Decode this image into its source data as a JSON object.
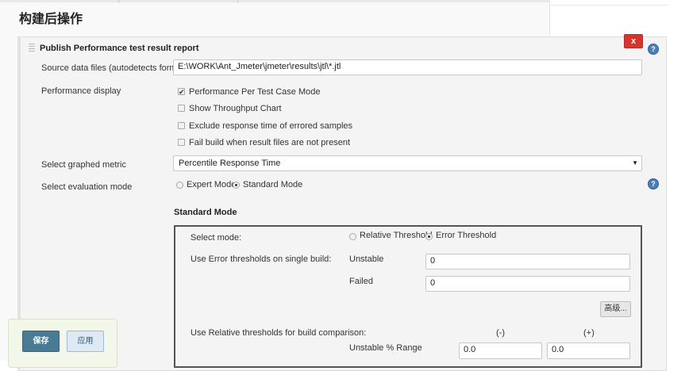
{
  "section": {
    "heading": "构建后操作"
  },
  "panel": {
    "title": "Publish Performance test result report",
    "delete_label": "x",
    "help_symbol": "?"
  },
  "form": {
    "source_label": "Source data files (autodetects format):",
    "source_value": "E:\\WORK\\Ant_Jmeter\\jmeter\\results\\jtl\\*.jtl",
    "display_label": "Performance display",
    "display_options": [
      {
        "label": "Performance Per Test Case Mode",
        "checked": true
      },
      {
        "label": "Show Throughput Chart",
        "checked": false
      },
      {
        "label": "Exclude response time of errored samples",
        "checked": false
      },
      {
        "label": "Fail build when result files are not present",
        "checked": false
      }
    ],
    "metric_label": "Select graphed metric",
    "metric_value": "Percentile Response Time",
    "eval_label": "Select evaluation mode",
    "eval_options": [
      {
        "label": "Expert Mode",
        "checked": false
      },
      {
        "label": "Standard Mode",
        "checked": true
      }
    ]
  },
  "standard_mode": {
    "heading": "Standard Mode",
    "select_mode_label": "Select mode:",
    "mode_options": [
      {
        "label": "Relative Threshold",
        "checked": false
      },
      {
        "label": "Error Threshold",
        "checked": true
      }
    ],
    "error_thresholds_label": "Use Error thresholds on single build:",
    "unstable_label": "Unstable",
    "unstable_value": "0",
    "failed_label": "Failed",
    "failed_value": "0",
    "advanced_label": "高级...",
    "relative_label": "Use Relative thresholds for build comparison:",
    "minus_header": "(-)",
    "plus_header": "(+)",
    "unstable_range_label": "Unstable % Range",
    "range_minus_value": "0.0",
    "range_plus_value": "0.0"
  },
  "actions": {
    "save_label": "保存",
    "apply_label": "应用"
  },
  "colors": {
    "delete_button": "#d9342b",
    "save_button": "#4a7b94",
    "apply_button": "#dfe9f4",
    "help_icon": "#4a7fb8"
  }
}
